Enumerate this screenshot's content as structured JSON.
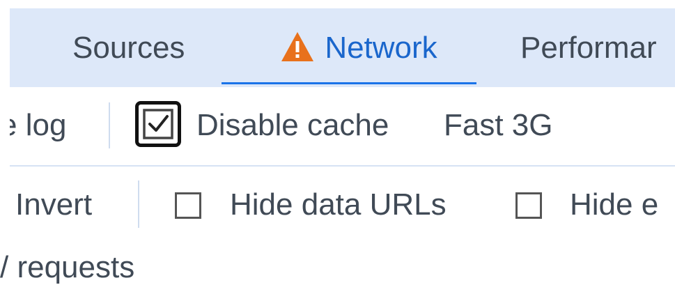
{
  "tabs": {
    "sources": "Sources",
    "network": "Network",
    "performance": "Performar"
  },
  "toolbar1": {
    "preserve_log_partial": "e log",
    "disable_cache_label": "Disable cache",
    "disable_cache_checked": true,
    "throttling": "Fast 3G"
  },
  "toolbar2": {
    "invert_label": "Invert",
    "hide_data_urls_label": "Hide data URLs",
    "hide_data_urls_checked": false,
    "hide_ext_partial": "Hide e",
    "hide_ext_checked": false
  },
  "partial_row": {
    "text": "/ requests"
  },
  "colors": {
    "tabbar_bg": "#dde8f9",
    "active_tab_text": "#1a66cc",
    "active_tab_underline": "#1a73e8",
    "warning_icon": "#e8711c",
    "separator": "#cfdcef"
  },
  "icons": {
    "network_tab": "warning-triangle-icon",
    "disable_cache_checkbox": "checkbox-checked-icon",
    "hide_data_urls_checkbox": "checkbox-unchecked-icon",
    "hide_ext_checkbox": "checkbox-unchecked-icon"
  }
}
